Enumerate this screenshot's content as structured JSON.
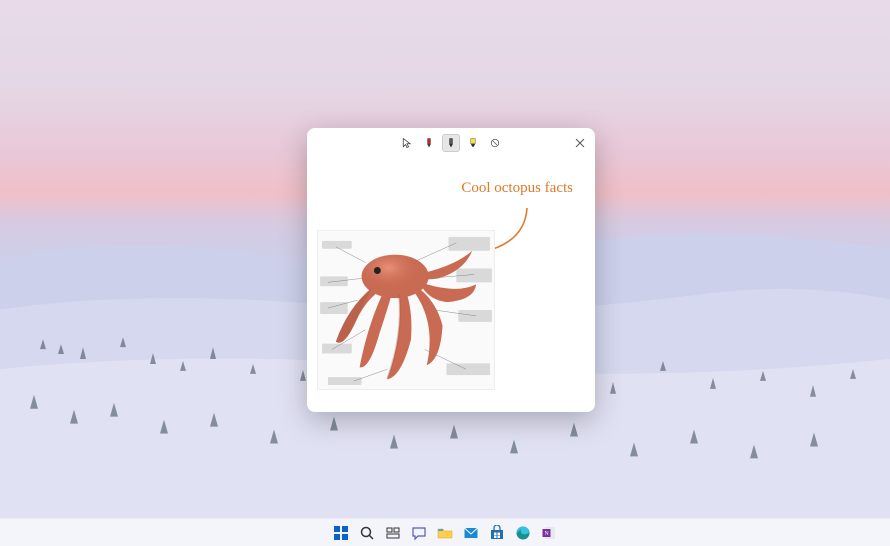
{
  "snip": {
    "annotation_text": "Cool octopus facts",
    "annotation_color": "#e07a2a",
    "tools": {
      "cursor": "cursor",
      "pen_red": "ballpoint-pen",
      "pen_black": "pencil",
      "highlighter": "highlighter",
      "eraser": "eraser"
    },
    "selected_tool": "pencil",
    "close_label": "Close"
  },
  "taskbar": {
    "items": [
      {
        "name": "start",
        "label": "Start"
      },
      {
        "name": "search",
        "label": "Search"
      },
      {
        "name": "task-view",
        "label": "Task View"
      },
      {
        "name": "chat",
        "label": "Chat"
      },
      {
        "name": "file-explorer",
        "label": "File Explorer"
      },
      {
        "name": "mail",
        "label": "Mail"
      },
      {
        "name": "store",
        "label": "Microsoft Store"
      },
      {
        "name": "edge",
        "label": "Edge"
      },
      {
        "name": "onenote",
        "label": "OneNote"
      }
    ]
  }
}
